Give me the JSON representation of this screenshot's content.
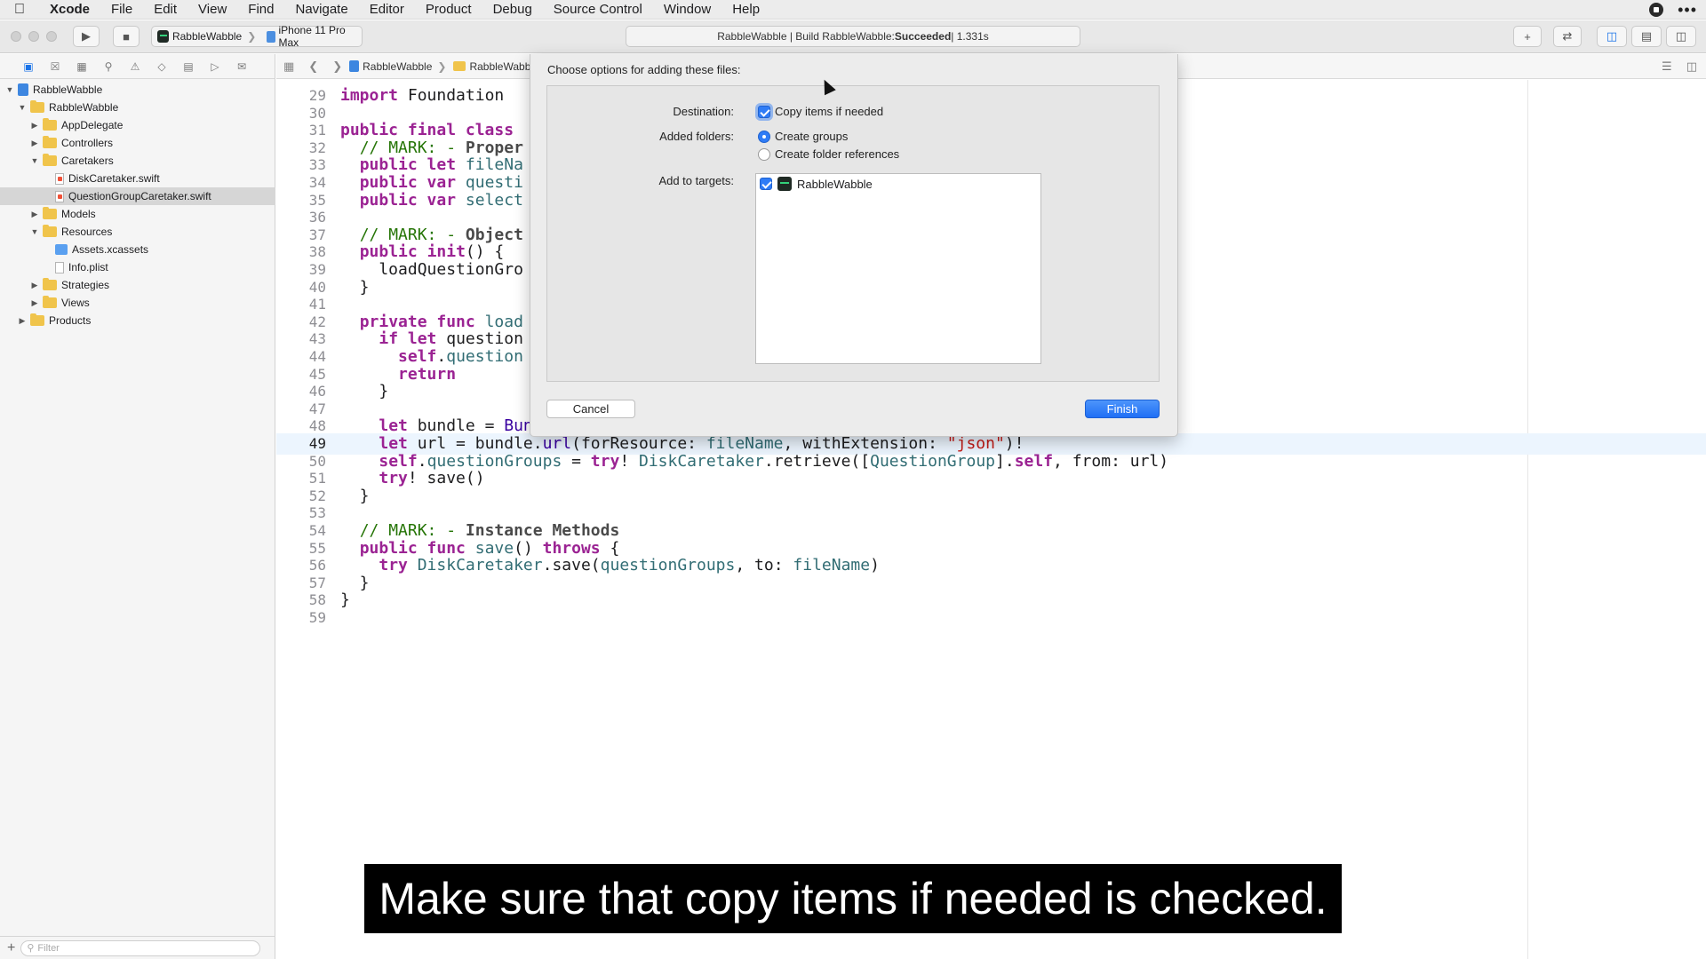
{
  "menubar": {
    "app": "Xcode",
    "items": [
      "File",
      "Edit",
      "View",
      "Find",
      "Navigate",
      "Editor",
      "Product",
      "Debug",
      "Source Control",
      "Window",
      "Help"
    ]
  },
  "toolbar": {
    "scheme_target": "RabbleWabble",
    "scheme_device": "iPhone 11 Pro Max",
    "activity_prefix": "RabbleWabble | Build RabbleWabble: ",
    "activity_status": "Succeeded",
    "activity_suffix": " | 1.331s"
  },
  "navigator": {
    "rows": [
      {
        "label": "RabbleWabble",
        "kind": "project",
        "indent": 0,
        "disclosure": "open"
      },
      {
        "label": "RabbleWabble",
        "kind": "folder",
        "indent": 1,
        "disclosure": "open"
      },
      {
        "label": "AppDelegate",
        "kind": "folder",
        "indent": 2,
        "disclosure": "closed"
      },
      {
        "label": "Controllers",
        "kind": "folder",
        "indent": 2,
        "disclosure": "closed"
      },
      {
        "label": "Caretakers",
        "kind": "folder",
        "indent": 2,
        "disclosure": "open"
      },
      {
        "label": "DiskCaretaker.swift",
        "kind": "swift",
        "indent": 3,
        "disclosure": ""
      },
      {
        "label": "QuestionGroupCaretaker.swift",
        "kind": "swift",
        "indent": 3,
        "disclosure": "",
        "selected": true
      },
      {
        "label": "Models",
        "kind": "folder",
        "indent": 2,
        "disclosure": "closed"
      },
      {
        "label": "Resources",
        "kind": "folder",
        "indent": 2,
        "disclosure": "open"
      },
      {
        "label": "Assets.xcassets",
        "kind": "assets",
        "indent": 3,
        "disclosure": ""
      },
      {
        "label": "Info.plist",
        "kind": "file",
        "indent": 3,
        "disclosure": ""
      },
      {
        "label": "Strategies",
        "kind": "folder",
        "indent": 2,
        "disclosure": "closed"
      },
      {
        "label": "Views",
        "kind": "folder",
        "indent": 2,
        "disclosure": "closed"
      },
      {
        "label": "Products",
        "kind": "folder",
        "indent": 1,
        "disclosure": "closed"
      }
    ],
    "filter_placeholder": "Filter"
  },
  "jumpbar": {
    "crumbs": [
      "RabbleWabble",
      "RabbleWabble"
    ]
  },
  "editor": {
    "current_line": "49",
    "lines": [
      {
        "n": "29",
        "html": "<span class='kw'>import</span> Foundation"
      },
      {
        "n": "30",
        "html": ""
      },
      {
        "n": "31",
        "html": "<span class='kw'>public final class</span>"
      },
      {
        "n": "32",
        "html": "  <span class='cm'>// MARK: - <b>Proper</b></span>"
      },
      {
        "n": "33",
        "html": "  <span class='kw'>public let</span> <span class='pr'>fileNa</span>"
      },
      {
        "n": "34",
        "html": "  <span class='kw'>public var</span> <span class='pr'>questi</span>"
      },
      {
        "n": "35",
        "html": "  <span class='kw'>public var</span> <span class='pr'>select</span>"
      },
      {
        "n": "36",
        "html": ""
      },
      {
        "n": "37",
        "html": "  <span class='cm'>// MARK: - <b>Object</b></span>"
      },
      {
        "n": "38",
        "html": "  <span class='kw'>public</span> <span class='kw'>init</span>() {"
      },
      {
        "n": "39",
        "html": "    loadQuestionGro"
      },
      {
        "n": "40",
        "html": "  }"
      },
      {
        "n": "41",
        "html": ""
      },
      {
        "n": "42",
        "html": "  <span class='kw'>private func</span> <span class='pr'>load</span>"
      },
      {
        "n": "43",
        "html": "    <span class='kw'>if let</span> question                                                     <span class='pr'>fileName</span>) {"
      },
      {
        "n": "44",
        "html": "      <span class='kw'>self</span>.<span class='pr'>question</span>"
      },
      {
        "n": "45",
        "html": "      <span class='kw'>return</span>"
      },
      {
        "n": "46",
        "html": "    }"
      },
      {
        "n": "47",
        "html": ""
      },
      {
        "n": "48",
        "html": "    <span class='kw'>let</span> bundle = <span class='ty'>Bundle</span>.<span class='ty'>main</span>"
      },
      {
        "n": "49",
        "html": "    <span class='kw'>let</span> url = bundle.<span class='ty'>url</span>(forResource: <span class='pr'>fileName</span>, withExtension: <span class='st'>\"json\"</span>)!"
      },
      {
        "n": "50",
        "html": "    <span class='kw'>self</span>.<span class='pr'>questionGroups</span> = <span class='kw'>try</span>! <span class='pr'>DiskCaretaker</span>.retrieve([<span class='pr'>QuestionGroup</span>].<span class='kw'>self</span>, from: url)"
      },
      {
        "n": "51",
        "html": "    <span class='kw'>try</span>! save()"
      },
      {
        "n": "52",
        "html": "  }"
      },
      {
        "n": "53",
        "html": ""
      },
      {
        "n": "54",
        "html": "  <span class='cm'>// MARK: - <b>Instance Methods</b></span>"
      },
      {
        "n": "55",
        "html": "  <span class='kw'>public func</span> <span class='pr'>save</span>() <span class='kw'>throws</span> {"
      },
      {
        "n": "56",
        "html": "    <span class='kw'>try</span> <span class='pr'>DiskCaretaker</span>.save(<span class='pr'>questionGroups</span>, to: <span class='pr'>fileName</span>)"
      },
      {
        "n": "57",
        "html": "  }"
      },
      {
        "n": "58",
        "html": "}"
      },
      {
        "n": "59",
        "html": ""
      }
    ]
  },
  "dialog": {
    "title": "Choose options for adding these files:",
    "destination_label": "Destination:",
    "copy_items": "Copy items if needed",
    "added_folders_label": "Added folders:",
    "create_groups": "Create groups",
    "create_folder_refs": "Create folder references",
    "add_to_targets_label": "Add to targets:",
    "target_name": "RabbleWabble",
    "cancel": "Cancel",
    "finish": "Finish"
  },
  "caption": "Make sure that copy items if needed is checked."
}
